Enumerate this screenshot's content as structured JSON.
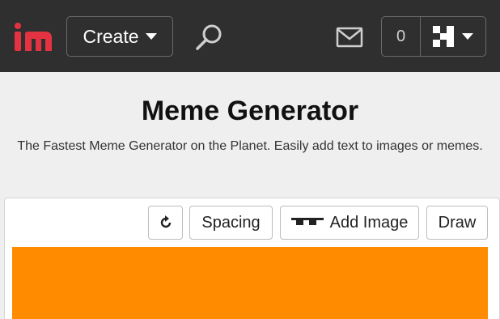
{
  "header": {
    "logo_text": "im",
    "logo_icon": "imgflip-logo",
    "create_label": "Create",
    "search_icon": "search-icon",
    "mail_icon": "mail-icon",
    "notification_count": "0",
    "user_icon": "avatar-icon"
  },
  "main": {
    "title": "Meme Generator",
    "subtitle": "The Fastest Meme Generator on the Planet. Easily add text to images or memes."
  },
  "toolbar": {
    "rotate_icon": "rotate-icon",
    "spacing_label": "Spacing",
    "add_image_label": "Add Image",
    "add_image_icon": "sunglasses-icon",
    "draw_label": "Draw"
  },
  "colors": {
    "topbar_bg": "#2f2f2f",
    "logo_i": "#e33342",
    "canvas_bg": "#ff8c00",
    "page_bg": "#efefef"
  }
}
